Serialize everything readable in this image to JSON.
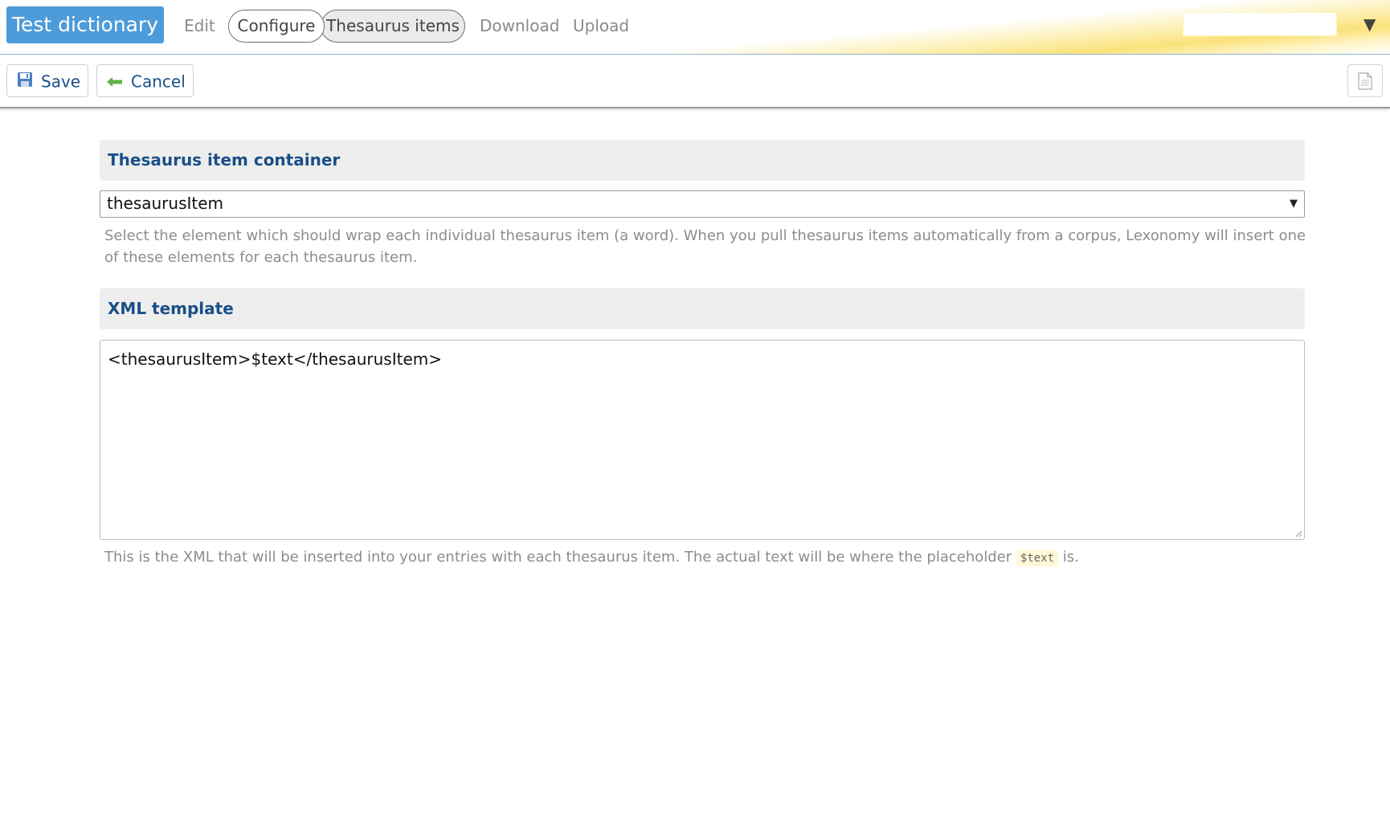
{
  "header": {
    "dictionary_title": "Test dictionary",
    "nav": {
      "edit": "Edit",
      "configure": "Configure",
      "thesaurus_items": "Thesaurus items",
      "download": "Download",
      "upload": "Upload"
    },
    "user_caret": "▼",
    "accent_color": "#4d9bd9"
  },
  "toolbar": {
    "save_label": "Save",
    "cancel_label": "Cancel"
  },
  "sections": {
    "container": {
      "heading": "Thesaurus item container",
      "selected_value": "thesaurusItem",
      "help": "Select the element which should wrap each individual thesaurus item (a word). When you pull thesaurus items automatically from a corpus, Lexonomy will insert one of these elements for each thesaurus item."
    },
    "template": {
      "heading": "XML template",
      "value": "<thesaurusItem>$text</thesaurusItem>",
      "help_before": "This is the XML that will be inserted into your entries with each thesaurus item. The actual text will be where the placeholder",
      "help_code": "$text",
      "help_after": "is."
    }
  },
  "icons": {
    "save": "floppy-disk-icon",
    "cancel": "back-arrow-icon",
    "doc": "document-icon",
    "select": "dropdown-caret-icon"
  }
}
